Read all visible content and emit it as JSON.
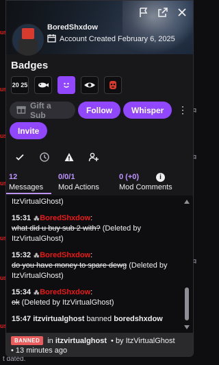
{
  "header": {
    "username": "BoredShxdow",
    "account_created": "Account Created February 6, 2025"
  },
  "icons": {
    "flag": "flag-icon",
    "popout": "popout-icon",
    "close": "close-icon",
    "calendar": "calendar-icon",
    "gift": "gift-icon",
    "more": "more-vertical-icon",
    "check": "check-icon",
    "clock": "clock-icon",
    "warning": "warning-icon",
    "add_user": "add-user-icon",
    "info": "info-icon"
  },
  "badges": {
    "title": "Badges",
    "items": [
      {
        "name": "badge-2025",
        "text": "20 25"
      },
      {
        "name": "badge-fish",
        "text": ""
      },
      {
        "name": "badge-smiley",
        "text": ""
      },
      {
        "name": "badge-eye",
        "text": ""
      },
      {
        "name": "badge-mask",
        "text": ""
      }
    ]
  },
  "actions": {
    "gift_label": "Gift a Sub",
    "follow_label": "Follow",
    "whisper_label": "Whisper",
    "invite_label": "Invite",
    "more_glyph": "⋮"
  },
  "tabs": [
    {
      "count": "12",
      "label": "Messages"
    },
    {
      "count": "0/0/1",
      "label": "Mod Actions"
    },
    {
      "count": "0 (+0)",
      "label": "Mod Comments"
    }
  ],
  "info_glyph": "i",
  "log": {
    "top_fragment": "ItzVirtualGhost)",
    "messages": [
      {
        "time": "15:31",
        "name": "BoredShxdow",
        "text": "what did u buy sub 2 with?",
        "note": " (Deleted by ItzVirtualGhost)"
      },
      {
        "time": "15:32",
        "name": "BoredShxdow",
        "text": "do you have money to spare dewg",
        "note": " (Deleted by ItzVirtualGhost)"
      },
      {
        "time": "15:34",
        "name": "BoredShxdow",
        "text": "ok",
        "note": " (Deleted by ItzVirtualGhost)"
      }
    ],
    "ban_event": {
      "time": "15:47",
      "moderator": "itzvirtualghost",
      "verb": "banned",
      "target": "boredshxdow"
    }
  },
  "ban_status": {
    "pill": "BANNED",
    "in_text": "in",
    "channel": "itzvirtualghost",
    "by_text": "• by",
    "moderator": "ItzVirtualGhost",
    "when": "• 13 minutes ago"
  },
  "background": {
    "bottom_text": "t dated."
  },
  "colors": {
    "accent": "#9147ff",
    "accent_light": "#bf94ff",
    "username_red": "#e91916",
    "banned_red": "#eb5d5d"
  }
}
